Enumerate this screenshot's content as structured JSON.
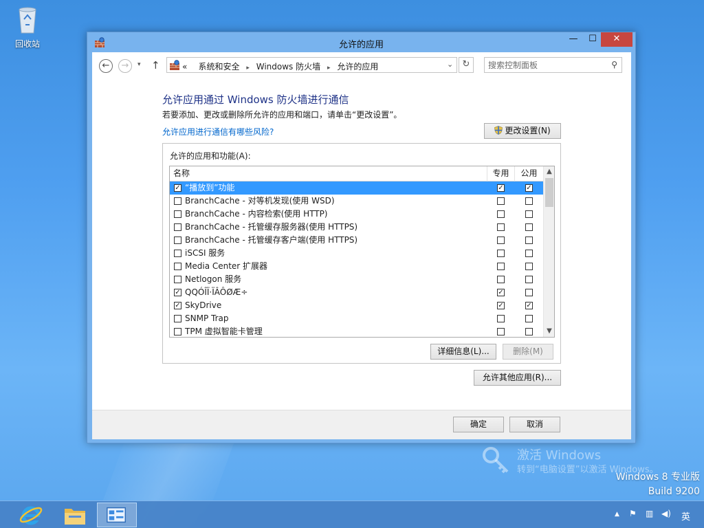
{
  "desktop": {
    "recycle_bin_label": "回收站",
    "watermark_line1": "激活 Windows",
    "watermark_line2": "转到“电脑设置”以激活 Windows。",
    "edition": "Windows 8 专业版",
    "build": "Build 9200"
  },
  "window": {
    "title": "允许的应用",
    "minimize_glyph": "—",
    "maximize_glyph": "☐",
    "close_glyph": "✕"
  },
  "navigation": {
    "back_glyph": "←",
    "forward_glyph": "→",
    "history_glyph": "▾",
    "up_glyph": "↑",
    "breadcrumb_prefix": "«",
    "breadcrumbs": [
      "系统和安全",
      "Windows 防火墙",
      "允许的应用"
    ],
    "separator_glyph": "▸",
    "address_dropdown_glyph": "⌄",
    "refresh_glyph": "↻",
    "search_placeholder": "搜索控制面板",
    "search_glyph": "⚲"
  },
  "content": {
    "heading": "允许应用通过 Windows 防火墙进行通信",
    "description": "若要添加、更改或删除所允许的应用和端口，请单击“更改设置”。",
    "risk_link": "允许应用进行通信有哪些风险?",
    "change_settings_button": "更改设置(N)",
    "group_label": "允许的应用和功能(A):",
    "columns": {
      "name": "名称",
      "private": "专用",
      "public": "公用"
    },
    "scroll_up_glyph": "▲",
    "scroll_down_glyph": "▼",
    "details_button": "详细信息(L)...",
    "remove_button": "删除(M)",
    "allow_other_button": "允许其他应用(R)..."
  },
  "apps": [
    {
      "name": "“播放到”功能",
      "enabled": true,
      "private": true,
      "public": true,
      "selected": true
    },
    {
      "name": "BranchCache - 对等机发现(使用 WSD)",
      "enabled": false,
      "private": false,
      "public": false,
      "selected": false
    },
    {
      "name": "BranchCache - 内容检索(使用 HTTP)",
      "enabled": false,
      "private": false,
      "public": false,
      "selected": false
    },
    {
      "name": "BranchCache - 托管缓存服务器(使用 HTTPS)",
      "enabled": false,
      "private": false,
      "public": false,
      "selected": false
    },
    {
      "name": "BranchCache - 托管缓存客户端(使用 HTTPS)",
      "enabled": false,
      "private": false,
      "public": false,
      "selected": false
    },
    {
      "name": "iSCSI 服务",
      "enabled": false,
      "private": false,
      "public": false,
      "selected": false
    },
    {
      "name": "Media Center 扩展器",
      "enabled": false,
      "private": false,
      "public": false,
      "selected": false
    },
    {
      "name": "Netlogon 服务",
      "enabled": false,
      "private": false,
      "public": false,
      "selected": false
    },
    {
      "name": "QQÓÎÏ·ÏÂÔØÆ÷",
      "enabled": true,
      "private": true,
      "public": false,
      "selected": false
    },
    {
      "name": "SkyDrive",
      "enabled": true,
      "private": true,
      "public": true,
      "selected": false
    },
    {
      "name": "SNMP Trap",
      "enabled": false,
      "private": false,
      "public": false,
      "selected": false
    },
    {
      "name": "TPM 虚拟智能卡管理",
      "enabled": false,
      "private": false,
      "public": false,
      "selected": false
    }
  ],
  "footer": {
    "ok_button": "确定",
    "cancel_button": "取消"
  },
  "taskbar": {
    "tray_arrow_glyph": "▲",
    "tray_flag_glyph": "⚑",
    "tray_network_glyph": "▥",
    "tray_volume_glyph": "◀)",
    "ime_label": "英"
  },
  "colors": {
    "selection": "#3399ff",
    "heading": "#1e3287",
    "link": "#0066cc",
    "close_button": "#c7463f"
  }
}
